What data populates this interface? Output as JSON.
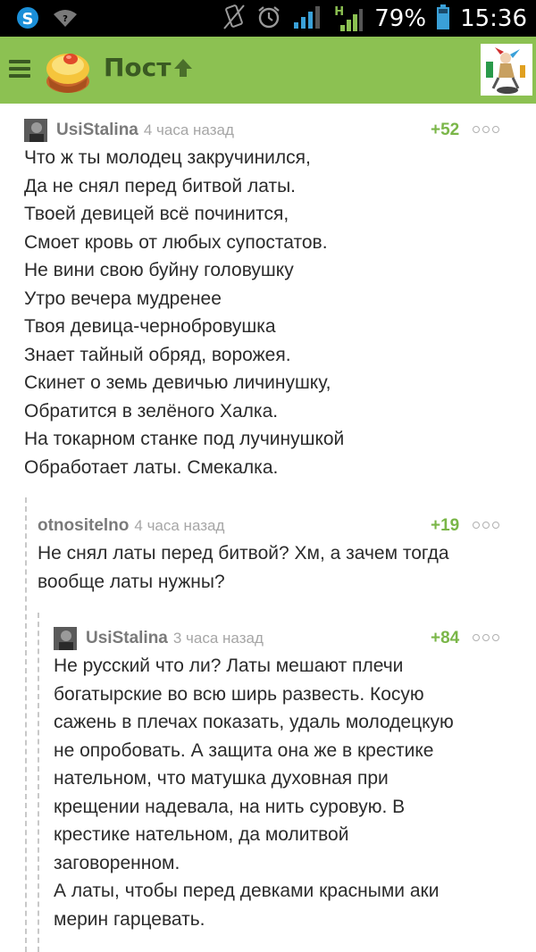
{
  "status": {
    "battery_percent": "79%",
    "time": "15:36",
    "network_type": "H"
  },
  "header": {
    "title": "Пост"
  },
  "comments": [
    {
      "user": "UsiStalina",
      "time": "4 часа назад",
      "score": "+52",
      "lines": [
        "Что ж ты молодец закручинился,",
        "Да не снял перед битвой латы.",
        "Твоей девицей всё починится,",
        "Смоет кровь от любых супостатов.",
        "Не вини свою буйну головушку",
        "Утро вечера мудренее",
        "Твоя девица-чернобровушка",
        "Знает тайный обряд, ворожея.",
        "Скинет о земь девичью личинушку,",
        "Обратится в зелёного Халка.",
        "На токарном станке под лучинушкой",
        "Обработает латы. Смекалка."
      ]
    },
    {
      "user": "otnositelno",
      "time": "4 часа назад",
      "score": "+19",
      "lines": [
        "Не снял латы перед битвой? Хм, а зачем тогда",
        "вообще латы нужны?"
      ]
    },
    {
      "user": "UsiStalina",
      "time": "3 часа назад",
      "score": "+84",
      "lines": [
        "Не русский что ли? Латы мешают плечи",
        "богатырские во всю ширь развесть. Косую",
        "сажень в плечах показать, удаль молодецкую",
        "не опробовать. А защита она же в крестике",
        "нательном, что матушка духовная при",
        "крещении надевала, на нить суровую. В",
        "крестике нательном, да молитвой",
        "заговоренном.",
        "А латы, чтобы перед девками красными аки",
        "мерин гарцевать."
      ]
    }
  ],
  "colors": {
    "appbar": "#8cc152",
    "score": "#7ab648",
    "username": "#7a7a7a"
  },
  "icons": [
    "skype-icon",
    "wifi-icon",
    "vibrate-icon",
    "alarm-icon",
    "signal-icon",
    "battery-icon",
    "menu-icon",
    "pikabu-logo-icon",
    "up-arrow-icon",
    "profile-avatar",
    "more-options-icon"
  ]
}
